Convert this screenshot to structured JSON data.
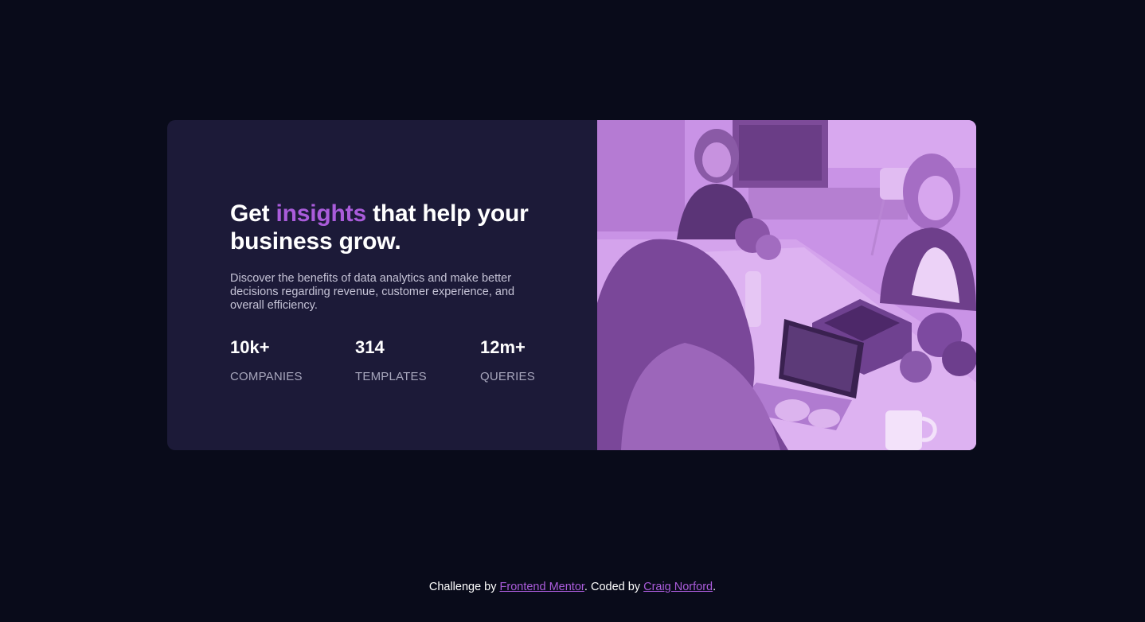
{
  "card": {
    "headline": {
      "before": "Get ",
      "accent": "insights",
      "after": " that help your business grow."
    },
    "description": "Discover the benefits of data analytics and make better decisions regarding revenue, customer experience, and overall efficiency.",
    "stats": [
      {
        "value": "10k+",
        "label": "COMPANIES"
      },
      {
        "value": "314",
        "label": "TEMPLATES"
      },
      {
        "value": "12m+",
        "label": "QUERIES"
      }
    ],
    "image": {
      "icon": "office-team-photo"
    }
  },
  "footer": {
    "prefix": "Challenge by ",
    "link1": "Frontend Mentor",
    "middle": ". Coded by ",
    "link2": "Craig Norford",
    "suffix": "."
  },
  "colors": {
    "background": "#090b1a",
    "card": "#1c1a38",
    "accent": "#aa5cdb",
    "image_tint": "#c98ee4"
  }
}
